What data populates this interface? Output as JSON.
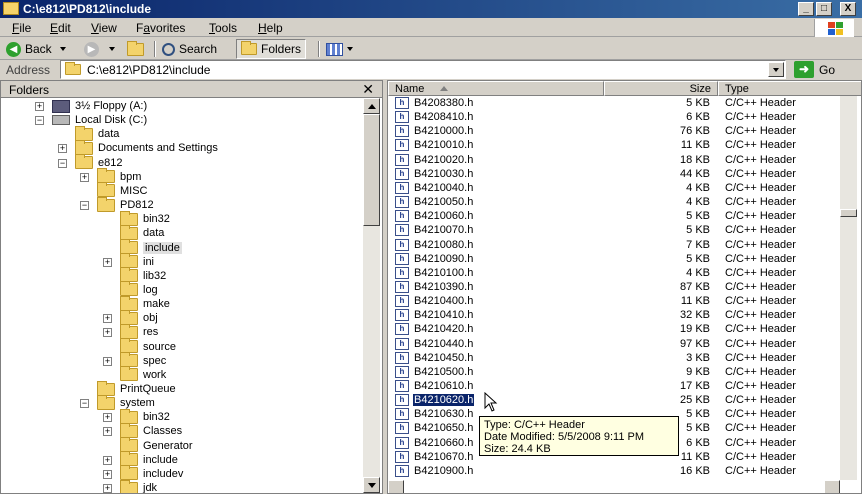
{
  "window": {
    "title": "C:\\e812\\PD812\\include",
    "controls": [
      "_",
      "□",
      "X"
    ]
  },
  "menu": {
    "items": [
      {
        "label": "File",
        "key": "F"
      },
      {
        "label": "Edit",
        "key": "E"
      },
      {
        "label": "View",
        "key": "V"
      },
      {
        "label": "Favorites",
        "key": "a"
      },
      {
        "label": "Tools",
        "key": "T"
      },
      {
        "label": "Help",
        "key": "H"
      }
    ]
  },
  "toolbar": {
    "back_label": "Back",
    "search_label": "Search",
    "folders_label": "Folders"
  },
  "address": {
    "label": "Address",
    "value": "C:\\e812\\PD812\\include",
    "go_label": "Go"
  },
  "folders_panel": {
    "title": "Folders",
    "close": "✕",
    "nodes": [
      {
        "label": "3½ Floppy (A:)",
        "level": 1,
        "expander": "+",
        "icon": "floppy-drive-icon"
      },
      {
        "label": "Local Disk (C:)",
        "level": 1,
        "expander": "−",
        "icon": "hard-drive-icon"
      },
      {
        "label": "data",
        "level": 2,
        "expander": "",
        "icon": "folder-icon"
      },
      {
        "label": "Documents and Settings",
        "level": 2,
        "expander": "+",
        "icon": "folder-icon"
      },
      {
        "label": "e812",
        "level": 2,
        "expander": "−",
        "icon": "folder-icon"
      },
      {
        "label": "bpm",
        "level": 3,
        "expander": "+",
        "icon": "folder-icon"
      },
      {
        "label": "MISC",
        "level": 3,
        "expander": "",
        "icon": "folder-icon"
      },
      {
        "label": "PD812",
        "level": 3,
        "expander": "−",
        "icon": "folder-icon"
      },
      {
        "label": "bin32",
        "level": 4,
        "expander": "",
        "icon": "folder-icon"
      },
      {
        "label": "data",
        "level": 4,
        "expander": "",
        "icon": "folder-icon"
      },
      {
        "label": "include",
        "level": 4,
        "expander": "",
        "icon": "folder-icon",
        "selected": true
      },
      {
        "label": "ini",
        "level": 4,
        "expander": "+",
        "icon": "folder-icon"
      },
      {
        "label": "lib32",
        "level": 4,
        "expander": "",
        "icon": "folder-icon"
      },
      {
        "label": "log",
        "level": 4,
        "expander": "",
        "icon": "folder-icon"
      },
      {
        "label": "make",
        "level": 4,
        "expander": "",
        "icon": "folder-icon"
      },
      {
        "label": "obj",
        "level": 4,
        "expander": "+",
        "icon": "folder-icon"
      },
      {
        "label": "res",
        "level": 4,
        "expander": "+",
        "icon": "folder-icon"
      },
      {
        "label": "source",
        "level": 4,
        "expander": "",
        "icon": "folder-icon"
      },
      {
        "label": "spec",
        "level": 4,
        "expander": "+",
        "icon": "folder-icon"
      },
      {
        "label": "work",
        "level": 4,
        "expander": "",
        "icon": "folder-icon"
      },
      {
        "label": "PrintQueue",
        "level": 3,
        "expander": "",
        "icon": "folder-icon"
      },
      {
        "label": "system",
        "level": 3,
        "expander": "−",
        "icon": "folder-icon"
      },
      {
        "label": "bin32",
        "level": 4,
        "expander": "+",
        "icon": "folder-icon"
      },
      {
        "label": "Classes",
        "level": 4,
        "expander": "+",
        "icon": "folder-icon"
      },
      {
        "label": "Generator",
        "level": 4,
        "expander": "",
        "icon": "folder-icon"
      },
      {
        "label": "include",
        "level": 4,
        "expander": "+",
        "icon": "folder-icon"
      },
      {
        "label": "includev",
        "level": 4,
        "expander": "+",
        "icon": "folder-icon"
      },
      {
        "label": "jdk",
        "level": 4,
        "expander": "+",
        "icon": "folder-icon"
      }
    ]
  },
  "file_list": {
    "columns": {
      "name": "Name",
      "size": "Size",
      "type": "Type"
    },
    "rows": [
      {
        "name": "B4208380.h",
        "size": "5 KB",
        "type": "C/C++ Header"
      },
      {
        "name": "B4208410.h",
        "size": "6 KB",
        "type": "C/C++ Header"
      },
      {
        "name": "B4210000.h",
        "size": "76 KB",
        "type": "C/C++ Header"
      },
      {
        "name": "B4210010.h",
        "size": "11 KB",
        "type": "C/C++ Header"
      },
      {
        "name": "B4210020.h",
        "size": "18 KB",
        "type": "C/C++ Header"
      },
      {
        "name": "B4210030.h",
        "size": "44 KB",
        "type": "C/C++ Header"
      },
      {
        "name": "B4210040.h",
        "size": "4 KB",
        "type": "C/C++ Header"
      },
      {
        "name": "B4210050.h",
        "size": "4 KB",
        "type": "C/C++ Header"
      },
      {
        "name": "B4210060.h",
        "size": "5 KB",
        "type": "C/C++ Header"
      },
      {
        "name": "B4210070.h",
        "size": "5 KB",
        "type": "C/C++ Header"
      },
      {
        "name": "B4210080.h",
        "size": "7 KB",
        "type": "C/C++ Header"
      },
      {
        "name": "B4210090.h",
        "size": "5 KB",
        "type": "C/C++ Header"
      },
      {
        "name": "B4210100.h",
        "size": "4 KB",
        "type": "C/C++ Header"
      },
      {
        "name": "B4210390.h",
        "size": "87 KB",
        "type": "C/C++ Header"
      },
      {
        "name": "B4210400.h",
        "size": "11 KB",
        "type": "C/C++ Header"
      },
      {
        "name": "B4210410.h",
        "size": "32 KB",
        "type": "C/C++ Header"
      },
      {
        "name": "B4210420.h",
        "size": "19 KB",
        "type": "C/C++ Header"
      },
      {
        "name": "B4210440.h",
        "size": "97 KB",
        "type": "C/C++ Header"
      },
      {
        "name": "B4210450.h",
        "size": "3 KB",
        "type": "C/C++ Header"
      },
      {
        "name": "B4210500.h",
        "size": "9 KB",
        "type": "C/C++ Header"
      },
      {
        "name": "B4210610.h",
        "size": "17 KB",
        "type": "C/C++ Header"
      },
      {
        "name": "B4210620.h",
        "size": "25 KB",
        "type": "C/C++ Header",
        "selected": true
      },
      {
        "name": "B4210630.h",
        "size": "5 KB",
        "type": "C/C++ Header"
      },
      {
        "name": "B4210650.h",
        "size": "5 KB",
        "type": "C/C++ Header"
      },
      {
        "name": "B4210660.h",
        "size": "6 KB",
        "type": "C/C++ Header"
      },
      {
        "name": "B4210670.h",
        "size": "11 KB",
        "type": "C/C++ Header"
      },
      {
        "name": "B4210900.h",
        "size": "16 KB",
        "type": "C/C++ Header"
      }
    ]
  },
  "tooltip": {
    "type": "Type: C/C++ Header",
    "modified": "Date Modified: 5/5/2008 9:11 PM",
    "size": "Size: 24.4 KB"
  },
  "colors": {
    "title_bar": "#0a246a",
    "selection": "#0a246a",
    "folder": "#f3d36b",
    "go_green": "#2ea02e",
    "tooltip_bg": "#ffffe1"
  }
}
